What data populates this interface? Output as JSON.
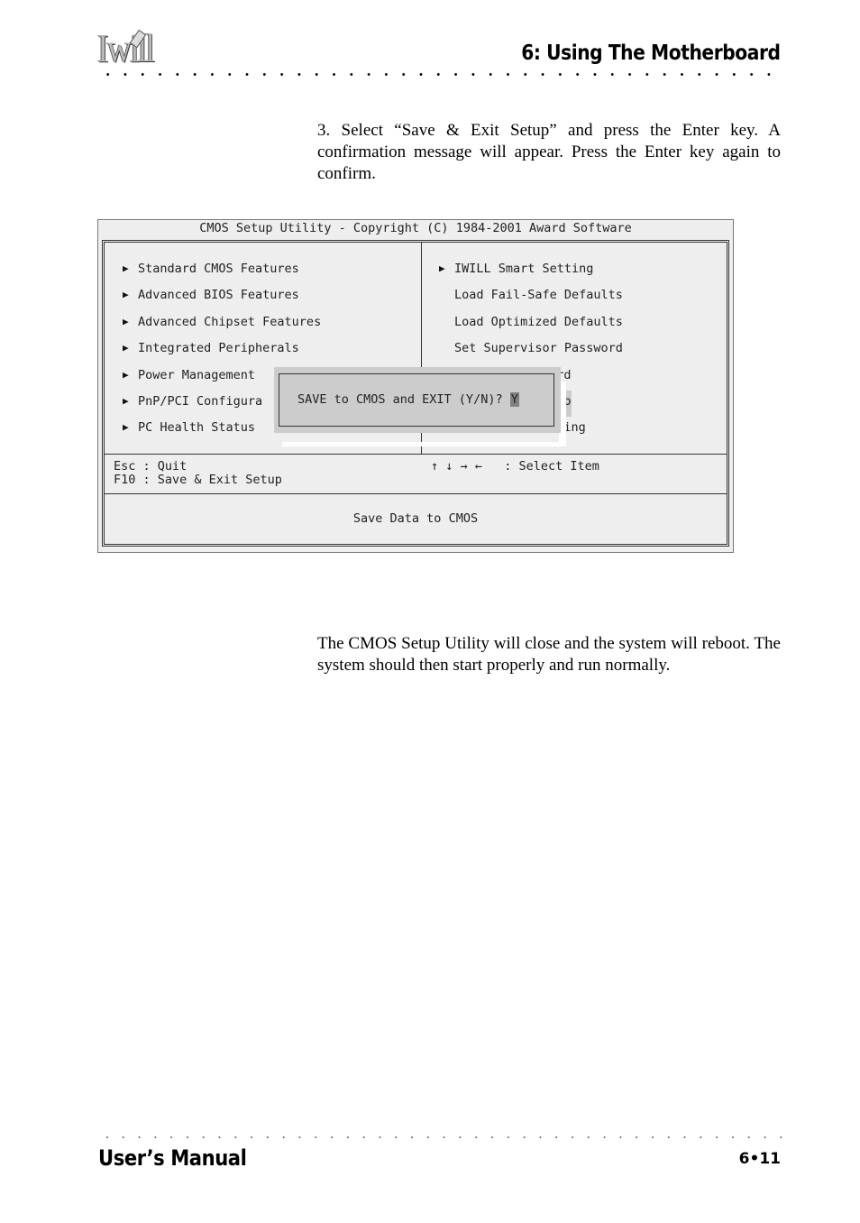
{
  "header": {
    "logo": "Iwill",
    "chapter_title": "6: Using The Motherboard"
  },
  "body": {
    "step_text": "3.  Select “Save & Exit Setup” and press the Enter key. A confirmation message will appear. Press the Enter key again to confirm.",
    "result_text": "The CMOS Setup Utility will close and the system will reboot. The system should then start properly and run normally."
  },
  "bios": {
    "title": "CMOS Setup Utility - Copyright (C) 1984-2001 Award Software",
    "left_menu": [
      {
        "label": "Standard CMOS Features",
        "submenu": true
      },
      {
        "label": "Advanced BIOS Features",
        "submenu": true
      },
      {
        "label": "Advanced Chipset Features",
        "submenu": true
      },
      {
        "label": "Integrated Peripherals",
        "submenu": true
      },
      {
        "label": "Power Management",
        "submenu": true
      },
      {
        "label": "PnP/PCI Configura",
        "submenu": true
      },
      {
        "label": "PC Health Status",
        "submenu": true
      }
    ],
    "right_menu": [
      {
        "label": "IWILL Smart Setting",
        "submenu": true
      },
      {
        "label": "Load Fail-Safe Defaults",
        "submenu": false
      },
      {
        "label": "Load Optimized Defaults",
        "submenu": false
      },
      {
        "label": "Set Supervisor Password",
        "submenu": false
      },
      {
        "label": "word",
        "submenu": false
      },
      {
        "label": "etup",
        "submenu": false
      },
      {
        "label": "Saving",
        "submenu": false
      }
    ],
    "hints": {
      "esc": "Esc : Quit",
      "f10": "F10 : Save & Exit Setup",
      "arrows": "↑ ↓ → ←   : Select Item"
    },
    "status": "Save Data to CMOS",
    "dialog": {
      "prompt": "SAVE to CMOS and EXIT (Y/N)? ",
      "value": "Y"
    },
    "arrow_glyph": "▶"
  },
  "footer": {
    "title": "User’s Manual",
    "page": "6•11"
  }
}
